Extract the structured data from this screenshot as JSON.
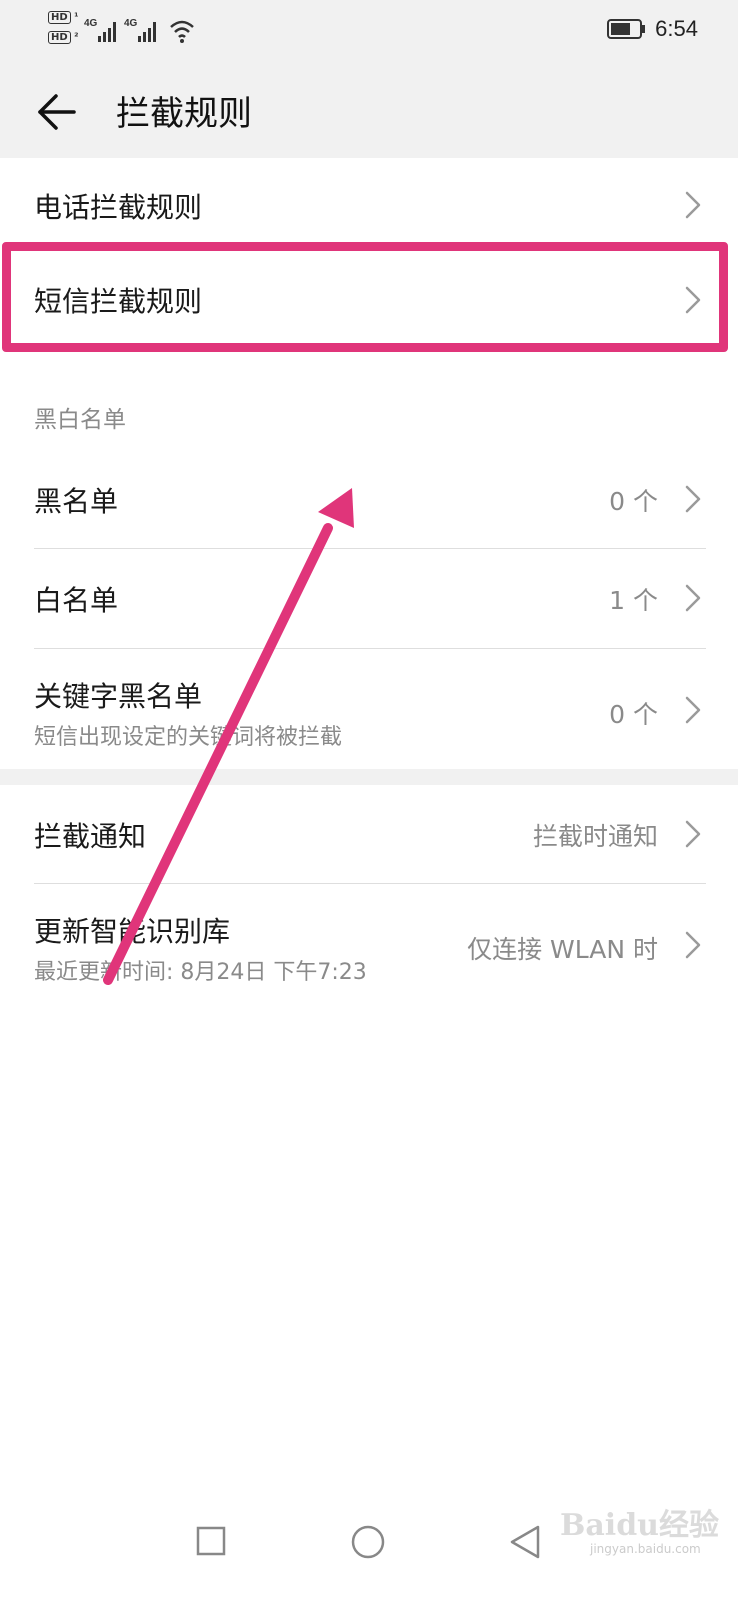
{
  "status_bar": {
    "hd1": "HD",
    "hd2": "HD",
    "net1": "4G",
    "net2": "4G",
    "time": "6:54",
    "icons": [
      "hd-icon",
      "signal-icon",
      "wifi-icon",
      "battery-icon"
    ]
  },
  "header": {
    "title": "拦截规则",
    "back_icon": "arrow-left-icon"
  },
  "rules": {
    "call_rules": "电话拦截规则",
    "sms_rules": "短信拦截规则"
  },
  "lists": {
    "section_title": "黑白名单",
    "blacklist": {
      "label": "黑名单",
      "value": "0 个"
    },
    "whitelist": {
      "label": "白名单",
      "value": "1 个"
    },
    "keyword_blacklist": {
      "label": "关键字黑名单",
      "description": "短信出现设定的关键词将被拦截",
      "value": "0 个"
    }
  },
  "settings": {
    "notification": {
      "label": "拦截通知",
      "value": "拦截时通知"
    },
    "update_library": {
      "label": "更新智能识别库",
      "description": "最近更新时间: 8月24日 下午7:23",
      "value": "仅连接 WLAN 时"
    }
  },
  "annotation": {
    "highlight_color": "#e0357a"
  },
  "nav": {
    "icons": [
      "square-icon",
      "circle-icon",
      "triangle-back-icon"
    ]
  },
  "watermark": {
    "text": "Baidu经验",
    "url": "jingyan.baidu.com"
  }
}
